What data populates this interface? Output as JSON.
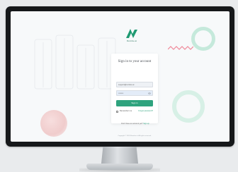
{
  "app": {
    "logo_text": "Rezolve.ai"
  },
  "signin": {
    "title": "Sign in to your account",
    "email_value": "support@rezolve.ai",
    "password_value": "••••••••",
    "signin_button": "Sign in",
    "remember_label": "Remember me",
    "forgot_link": "Forgot password?",
    "signup_prompt": "Don't have an account yet?",
    "signup_link": "Sign up"
  },
  "footer": {
    "text": "Copyright © 2024 Rezolve.ai. All rights reserved."
  },
  "colors": {
    "accent": "#2fa37e",
    "bezel": "#16181a",
    "screen_bg": "#f7f9fa"
  },
  "icons": {
    "logo": "rezolve-logo-icon",
    "password_toggle": "eye-icon"
  }
}
